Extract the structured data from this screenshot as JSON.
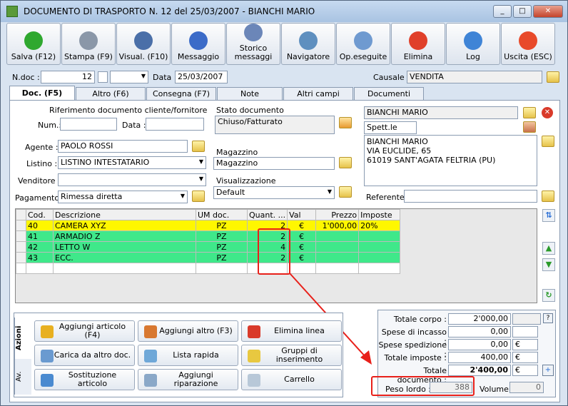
{
  "window": {
    "title": "DOCUMENTO DI TRASPORTO N. 12  del 25/03/2007 - BIANCHI MARIO"
  },
  "toolbar": [
    {
      "label": "Salva (F12)",
      "icon": "check-icon",
      "color": "#2fa82f"
    },
    {
      "label": "Stampa (F9)",
      "icon": "printer-icon",
      "color": "#8a97a8"
    },
    {
      "label": "Visual. (F10)",
      "icon": "wand-icon",
      "color": "#4a6fa8"
    },
    {
      "label": "Messaggio",
      "icon": "pen-icon",
      "color": "#3b6bc8"
    },
    {
      "label": "Storico messaggi",
      "icon": "mail-icon",
      "color": "#6b86b8"
    },
    {
      "label": "Navigatore",
      "icon": "compass-icon",
      "color": "#5e8fbf"
    },
    {
      "label": "Op.eseguite",
      "icon": "gears-icon",
      "color": "#6f9ad0"
    },
    {
      "label": "Elimina",
      "icon": "x-icon",
      "color": "#e0402a"
    },
    {
      "label": "Log",
      "icon": "magnifier-icon",
      "color": "#3f84d6"
    },
    {
      "label": "Uscita (ESC)",
      "icon": "power-icon",
      "color": "#e84a2a"
    }
  ],
  "header": {
    "ndoc_label": "N.doc :",
    "ndoc_value": "12",
    "data_label": "Data :",
    "data_value": "25/03/2007",
    "causale_label": "Causale :",
    "causale_value": "VENDITA"
  },
  "tabs": [
    "Doc. (F5)",
    "Altro (F6)",
    "Consegna (F7)",
    "Note",
    "Altri campi",
    "Documenti"
  ],
  "doc": {
    "rif_title": "Riferimento documento cliente/fornitore",
    "num_label": "Num.:",
    "data_label": "Data :",
    "stato_title": "Stato documento",
    "stato_value": "Chiuso/Fatturato",
    "agente_label": "Agente :",
    "agente_value": "PAOLO ROSSI",
    "listino_label": "Listino :",
    "listino_value": "LISTINO INTESTATARIO",
    "venditore_label": "Venditore :",
    "venditore_value": "",
    "pagamento_label": "Pagamento :",
    "pagamento_value": "Rimessa diretta",
    "magazzino_title": "Magazzino",
    "magazzino_value": "Magazzino",
    "visual_title": "Visualizzazione",
    "visual_value": "Default",
    "cliente_name": "BIANCHI MARIO",
    "spett": "Spett.le",
    "address": [
      "BIANCHI MARIO",
      "VIA EUCLIDE, 65",
      "61019 SANT'AGATA FELTRIA (PU)"
    ],
    "referente_label": "Referente"
  },
  "grid": {
    "headers": [
      "Cod.",
      "Descrizione",
      "UM doc.",
      "Quant. ...",
      "Val",
      "Prezzo",
      "Imposte"
    ],
    "rows": [
      [
        "40",
        "CAMERA XYZ",
        "PZ",
        "2",
        "€",
        "1'000,00",
        "20%"
      ],
      [
        "41",
        "ARMADIO Z",
        "PZ",
        "2",
        "€",
        "",
        ""
      ],
      [
        "42",
        "LETTO W",
        "PZ",
        "4",
        "€",
        "",
        ""
      ],
      [
        "43",
        "ECC.",
        "PZ",
        "2",
        "€",
        "",
        ""
      ]
    ]
  },
  "actions": {
    "tabs": [
      "Azioni",
      "Av."
    ],
    "buttons": [
      {
        "label": "Aggiungi articolo (F4)",
        "icon": "box-icon"
      },
      {
        "label": "Aggiungi altro (F3)",
        "icon": "grid-add-icon"
      },
      {
        "label": "Elimina linea",
        "icon": "delete-icon"
      },
      {
        "label": "Carica da altro doc.",
        "icon": "doc-load-icon"
      },
      {
        "label": "Lista rapida",
        "icon": "list-icon"
      },
      {
        "label": "Gruppi di inserimento",
        "icon": "star-group-icon"
      },
      {
        "label": "Sostituzione articolo",
        "icon": "swap-icon"
      },
      {
        "label": "Aggiungi riparazione",
        "icon": "repair-icon"
      },
      {
        "label": "Carrello",
        "icon": "cart-icon"
      }
    ]
  },
  "totals": {
    "rows": [
      {
        "label": "Totale corpo :",
        "value": "2'000,00"
      },
      {
        "label": "Spese di incasso :",
        "value": "0,00"
      },
      {
        "label": "Spese spedizione :",
        "value": "0,00",
        "cur": "€"
      },
      {
        "label": "Totale imposte :",
        "value": "400,00",
        "cur": "€"
      },
      {
        "label": "Totale documento :",
        "value": "2'400,00",
        "cur": "€"
      }
    ],
    "peso_label": "Peso lordo :",
    "peso_value": "388",
    "volume_label": "Volume :",
    "volume_value": "0",
    "help": "?"
  }
}
